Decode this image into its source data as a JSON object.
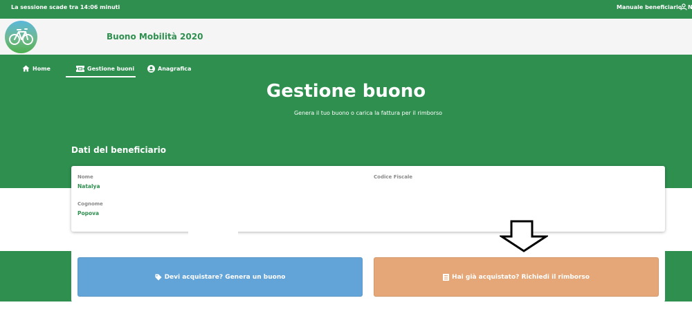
{
  "topbar": {
    "session_text": "La sessione scade tra 14:06 minuti",
    "manual_label": "Manuale beneficiario",
    "user_icon": "user-icon",
    "user_label_fragment": "N"
  },
  "header": {
    "logo_icon": "bicycle-icon",
    "app_title": "Buono Mobilità 2020"
  },
  "nav": {
    "items": [
      {
        "label": "Home",
        "icon": "home-icon",
        "active": false
      },
      {
        "label": "Gestione buoni",
        "icon": "ticket-icon",
        "active": true
      },
      {
        "label": "Anagrafica",
        "icon": "user-circle-icon",
        "active": false
      }
    ]
  },
  "hero": {
    "title": "Gestione buono",
    "subtitle": "Genera il tuo buono o carica la fattura per il rimborso"
  },
  "beneficiary": {
    "section_title": "Dati del beneficiario",
    "nome_label": "Nome",
    "nome_value": "Natalya",
    "cognome_label": "Cognome",
    "cognome_value": "Popova",
    "cf_label": "Codice Fiscale",
    "cf_value": ""
  },
  "actions": {
    "generate_label": "Devi acquistare? Genera un buono",
    "generate_icon": "tag-icon",
    "refund_label": "Hai già acquistato? Richiedi il rimborso",
    "refund_icon": "receipt-icon"
  },
  "colors": {
    "primary_green": "#2e8f4f",
    "button_blue": "#63a4d8",
    "button_orange": "#e5a777"
  }
}
